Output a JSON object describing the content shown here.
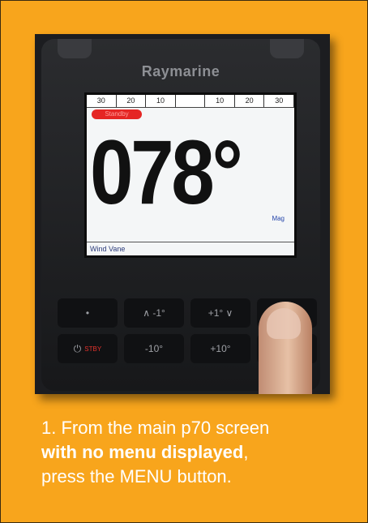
{
  "photo": {
    "brand": "Raymarine",
    "scale_labels": [
      "30",
      "20",
      "10",
      "",
      "10",
      "20",
      "30"
    ],
    "mode_label": "Standby",
    "heading": "078°",
    "heading_unit": "Mag",
    "footer_label": "Wind Vane",
    "keys_top": [
      "•",
      "∧ -1°",
      "+1° ∨",
      ""
    ],
    "keys_bottom": [
      "⏻",
      "-10°",
      "+10°",
      ""
    ],
    "standby_key": "STBY"
  },
  "caption": {
    "step": "1. From the main p70 screen",
    "emphasis": "with no menu displayed",
    "after_emphasis": ",",
    "instruction": "press the MENU button."
  }
}
